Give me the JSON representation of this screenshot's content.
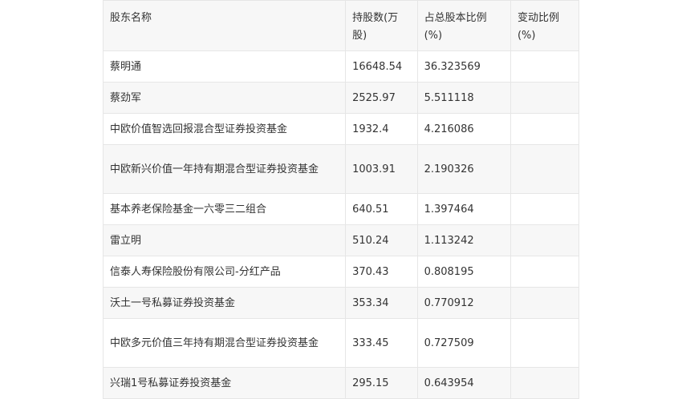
{
  "table": {
    "headers": {
      "name": "股东名称",
      "shares": "持股数(万股)",
      "ratio": "占总股本比例(%)",
      "change": "变动比例(%)"
    },
    "rows": [
      {
        "name": "蔡明通",
        "shares": "16648.54",
        "ratio": "36.323569",
        "change": ""
      },
      {
        "name": "蔡劲军",
        "shares": "2525.97",
        "ratio": "5.511118",
        "change": ""
      },
      {
        "name": "中欧价值智选回报混合型证券投资基金",
        "shares": "1932.4",
        "ratio": "4.216086",
        "change": ""
      },
      {
        "name": "中欧新兴价值一年持有期混合型证券投资基金",
        "shares": "1003.91",
        "ratio": "2.190326",
        "change": ""
      },
      {
        "name": "基本养老保险基金一六零三二组合",
        "shares": "640.51",
        "ratio": "1.397464",
        "change": ""
      },
      {
        "name": "雷立明",
        "shares": "510.24",
        "ratio": "1.113242",
        "change": ""
      },
      {
        "name": "信泰人寿保险股份有限公司-分红产品",
        "shares": "370.43",
        "ratio": "0.808195",
        "change": ""
      },
      {
        "name": "沃土一号私募证券投资基金",
        "shares": "353.34",
        "ratio": "0.770912",
        "change": ""
      },
      {
        "name": "中欧多元价值三年持有期混合型证券投资基金",
        "shares": "333.45",
        "ratio": "0.727509",
        "change": ""
      },
      {
        "name": "兴瑞1号私募证券投资基金",
        "shares": "295.15",
        "ratio": "0.643954",
        "change": ""
      }
    ]
  }
}
